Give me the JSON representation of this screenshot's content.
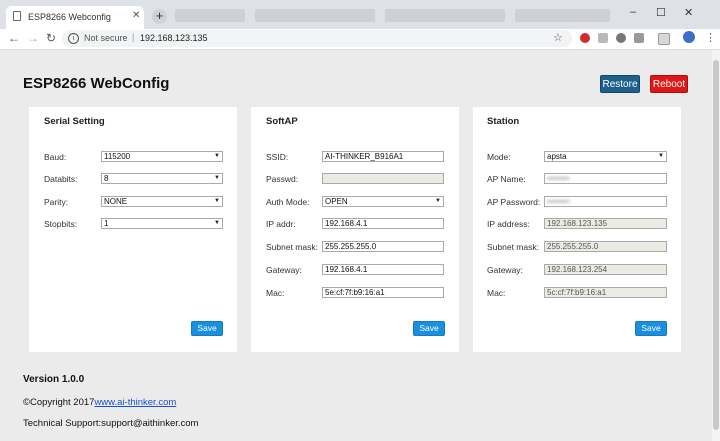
{
  "browser": {
    "tab_title": "ESP8266 Webconfig",
    "close_glyph": "✕",
    "new_tab_glyph": "+",
    "not_secure": "Not secure",
    "url": "192.168.123.135",
    "window_controls": [
      "–",
      "☐",
      "✕"
    ]
  },
  "page": {
    "title": "ESP8266 WebConfig",
    "restore_label": "Restore",
    "reboot_label": "Reboot",
    "save_label": "Save"
  },
  "serial": {
    "title": "Serial Setting",
    "rows": [
      {
        "label": "Baud:",
        "value": "115200"
      },
      {
        "label": "Databits:",
        "value": "8"
      },
      {
        "label": "Parity:",
        "value": "NONE"
      },
      {
        "label": "Stopbits:",
        "value": "1"
      }
    ]
  },
  "softap": {
    "title": "SoftAP",
    "rows": [
      {
        "label": "SSID:",
        "value": "AI-THINKER_B916A1"
      },
      {
        "label": "Passwd:",
        "value": ""
      },
      {
        "label": "Auth Mode:",
        "value": "OPEN"
      },
      {
        "label": "IP addr:",
        "value": "192.168.4.1"
      },
      {
        "label": "Subnet mask:",
        "value": "255.255.255.0"
      },
      {
        "label": "Gateway:",
        "value": "192.168.4.1"
      },
      {
        "label": "Mac:",
        "value": "5e:cf:7f:b9:16:a1"
      }
    ]
  },
  "station": {
    "title": "Station",
    "rows": [
      {
        "label": "Mode:",
        "value": "apsta"
      },
      {
        "label": "AP Name:",
        "value": "••••••••"
      },
      {
        "label": "AP Password:",
        "value": "••••••••"
      },
      {
        "label": "IP address:",
        "value": "192.168.123.135"
      },
      {
        "label": "Subnet mask:",
        "value": "255.255.255.0"
      },
      {
        "label": "Gateway:",
        "value": "192.168.123.254"
      },
      {
        "label": "Mac:",
        "value": "5c:cf:7f:b9:16:a1"
      }
    ]
  },
  "footer": {
    "version": "Version 1.0.0",
    "copyright_prefix": "©Copyright 2017",
    "copyright_link": "www.ai-thinker.com",
    "support": "Technical Support:support@aithinker.com"
  },
  "colors": {
    "restore": "#1e5f8c",
    "reboot": "#e01717",
    "save": "#1a8fe0",
    "page_bg": "#ebebeb"
  }
}
